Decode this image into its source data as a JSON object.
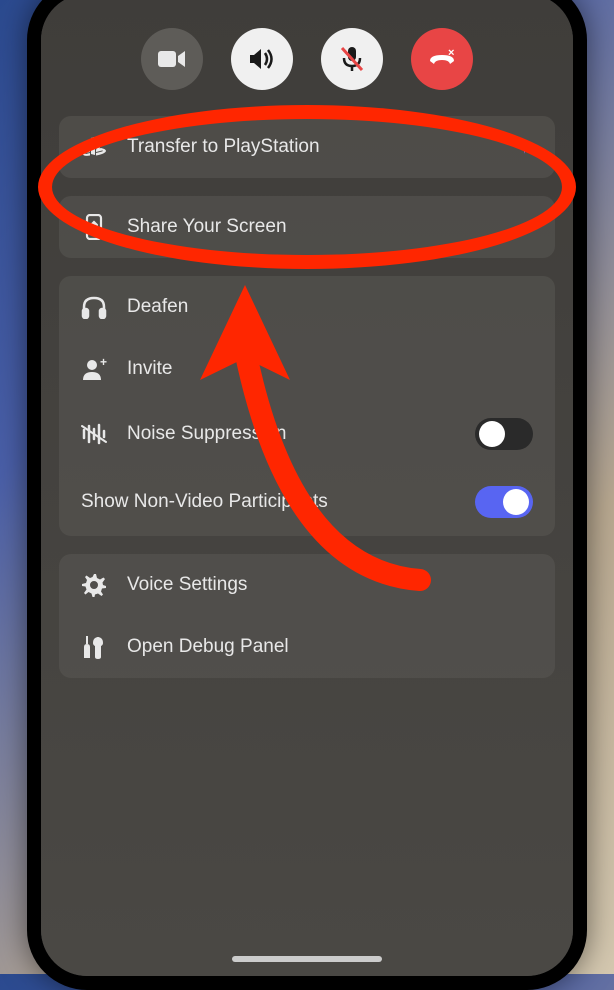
{
  "callControls": {
    "video": "video-icon",
    "speaker": "speaker-icon",
    "mute": "mic-muted-icon",
    "hangup": "phone-hangup-icon"
  },
  "menu": {
    "transfer": {
      "label": "Transfer to PlayStation",
      "icon": "playstation-icon"
    },
    "shareScreen": {
      "label": "Share Your Screen",
      "icon": "share-screen-icon"
    },
    "deafen": {
      "label": "Deafen",
      "icon": "headphones-icon"
    },
    "invite": {
      "label": "Invite",
      "icon": "person-plus-icon"
    },
    "noiseSuppression": {
      "label": "Noise Suppression",
      "icon": "noise-icon",
      "enabled": false
    },
    "showNonVideo": {
      "label": "Show Non-Video Participants",
      "enabled": true
    },
    "voiceSettings": {
      "label": "Voice Settings",
      "icon": "gear-icon"
    },
    "debugPanel": {
      "label": "Open Debug Panel",
      "icon": "wrench-icon"
    }
  },
  "annotation": {
    "highlight": "transfer-to-playstation",
    "color": "#ff2600"
  }
}
